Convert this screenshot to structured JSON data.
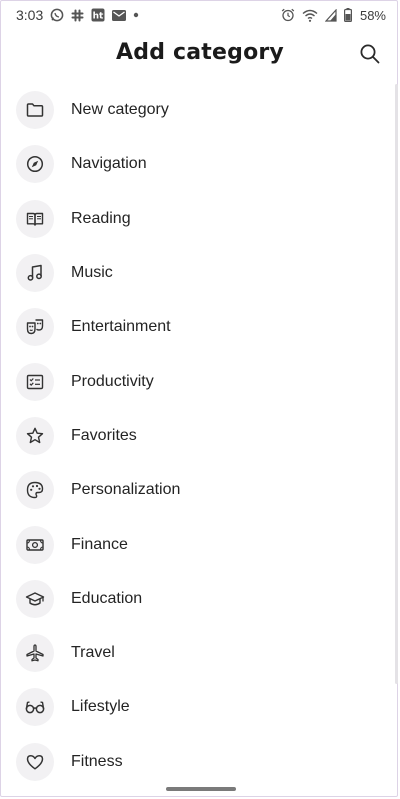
{
  "status_bar": {
    "time": "3:03",
    "battery": "58%",
    "left_icons": [
      "whatsapp-icon",
      "slack-icon",
      "ht-icon",
      "mail-icon",
      "dot-icon"
    ],
    "right_icons": [
      "alarm-icon",
      "wifi-icon",
      "signal-icon",
      "battery-icon"
    ],
    "ht_text": "ht"
  },
  "header": {
    "title": "Add category",
    "search_icon": "search-icon"
  },
  "categories": [
    {
      "label": "New category",
      "icon": "folder-icon"
    },
    {
      "label": "Navigation",
      "icon": "compass-icon"
    },
    {
      "label": "Reading",
      "icon": "book-icon"
    },
    {
      "label": "Music",
      "icon": "music-note-icon"
    },
    {
      "label": "Entertainment",
      "icon": "theater-masks-icon"
    },
    {
      "label": "Productivity",
      "icon": "checklist-icon"
    },
    {
      "label": "Favorites",
      "icon": "star-icon"
    },
    {
      "label": "Personalization",
      "icon": "palette-icon"
    },
    {
      "label": "Finance",
      "icon": "money-icon"
    },
    {
      "label": "Education",
      "icon": "graduation-cap-icon"
    },
    {
      "label": "Travel",
      "icon": "airplane-icon"
    },
    {
      "label": "Lifestyle",
      "icon": "glasses-icon"
    },
    {
      "label": "Fitness",
      "icon": "heart-icon"
    }
  ]
}
